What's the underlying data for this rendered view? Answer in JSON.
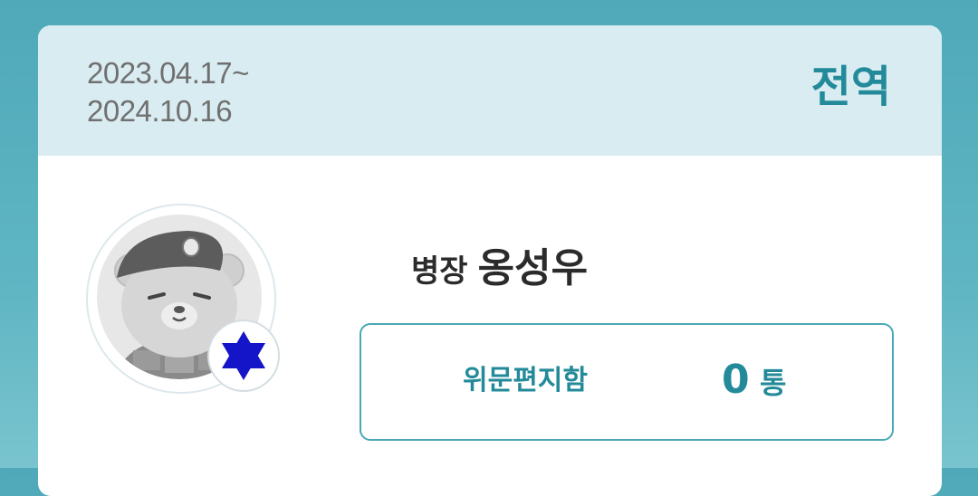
{
  "service_period": {
    "start": "2023.04.17~",
    "end": "2024.10.16"
  },
  "status_label": "전역",
  "soldier": {
    "rank": "병장",
    "name": "옹성우"
  },
  "letters_box": {
    "label": "위문편지함",
    "count": "0",
    "unit": "통"
  },
  "colors": {
    "accent": "#238a9a",
    "header_bg": "#d9ecf1",
    "page_bg": "#4fa9b9",
    "badge_star": "#1414c8"
  },
  "icons": {
    "avatar": "bear-soldier-avatar",
    "badge": "star-of-david-rank-icon"
  }
}
